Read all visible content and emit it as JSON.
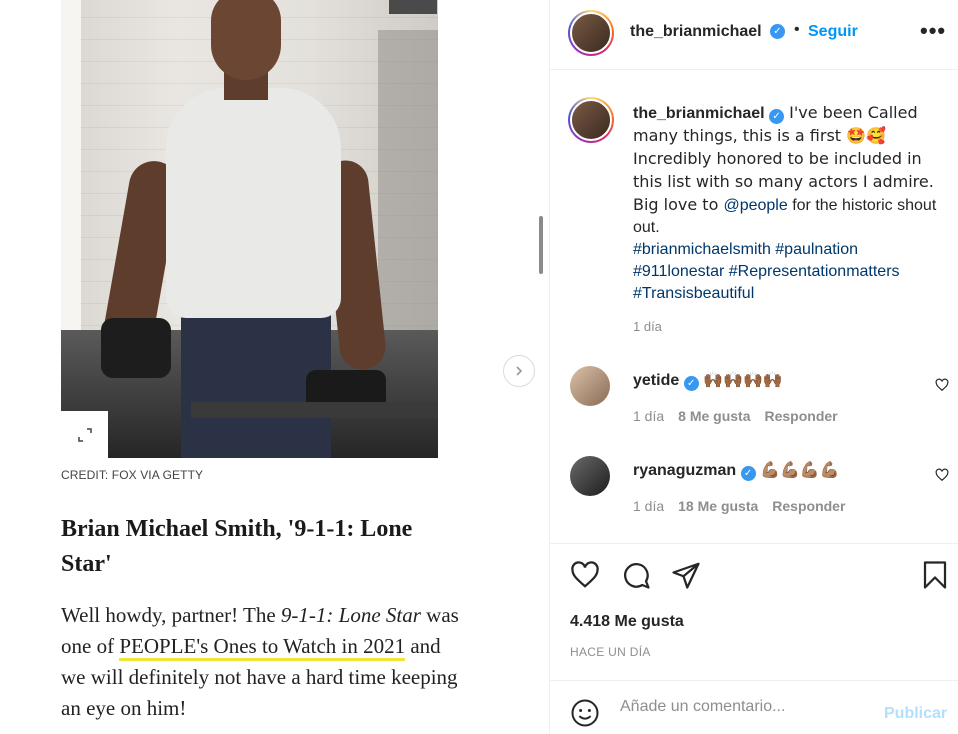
{
  "article": {
    "credit": "CREDIT: FOX VIA GETTY",
    "title": "Brian Michael Smith, '9-1-1: Lone Star'",
    "body_1": "Well howdy, partner! The ",
    "body_show": "9-1-1: Lone Star",
    "body_2": " was one of ",
    "body_link": "PEOPLE's Ones to Watch in 2021",
    "body_3": " and we will definitely not have a hard time keeping an eye on him!"
  },
  "header": {
    "username": "the_brianmichael",
    "dot": "•",
    "follow_label": "Seguir",
    "more": "•••"
  },
  "caption": {
    "username": "the_brianmichael",
    "text_1": " I've been Called many things, this is a first 🤩🥰 Incredibly honored to be included in this list with so many actors I admire. Big love to ",
    "mention": "@people",
    "text_2": " for the historic shout out.",
    "hashtags": "#brianmichaelsmith #paulnation #911lonestar #Representationmatters #Transisbeautiful",
    "time": "1 día"
  },
  "comments": [
    {
      "username": "yetide",
      "text": "🙌🏾🙌🏾🙌🏾🙌🏾",
      "time": "1 día",
      "likes": "8 Me gusta",
      "reply": "Responder"
    },
    {
      "username": "ryanaguzman",
      "text": "💪🏽💪🏽💪🏽💪🏽",
      "time": "1 día",
      "likes": "18 Me gusta",
      "reply": "Responder"
    }
  ],
  "stats": {
    "likes": "4.418 Me gusta",
    "ago": "HACE UN DÍA"
  },
  "comment_box": {
    "placeholder": "Añade un comentario...",
    "publish_label": "Publicar"
  },
  "icons": [
    "verified-icon",
    "more-icon",
    "heart-icon",
    "comment-icon",
    "share-icon",
    "bookmark-icon",
    "emoji-icon",
    "chevron-right-icon",
    "expand-icon"
  ],
  "colors": {
    "link": "#00376b",
    "follow": "#0095f6",
    "publish_disabled": "#b2dffc",
    "highlight": "#f2e337"
  }
}
